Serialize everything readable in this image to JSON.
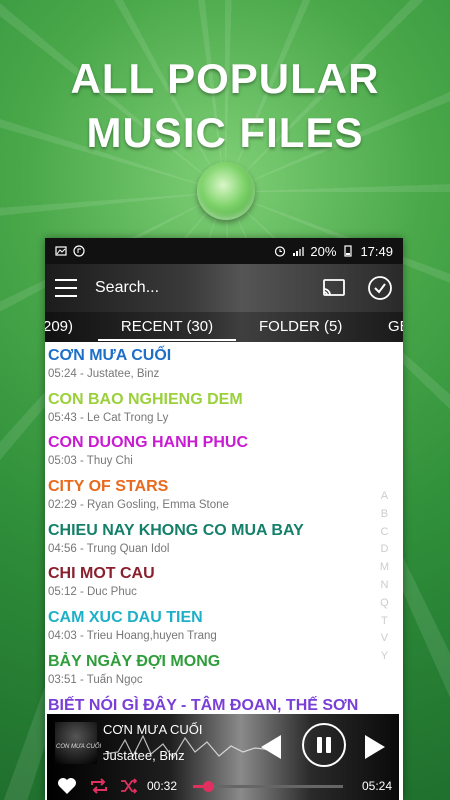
{
  "promo": {
    "line1": "ALL POPULAR",
    "line2": "MUSIC FILES"
  },
  "statusbar": {
    "battery": "20%",
    "time": "17:49"
  },
  "toolbar": {
    "search_placeholder": "Search..."
  },
  "tabs": [
    {
      "label": "209)"
    },
    {
      "label": "RECENT (30)"
    },
    {
      "label": "FOLDER (5)"
    },
    {
      "label": "GE"
    }
  ],
  "songs": [
    {
      "title": "CƠN MƯA CUỐI",
      "meta": "05:24 - Justatee, Binz",
      "color": "#1e6fc8"
    },
    {
      "title": "CON BAO NGHIENG DEM",
      "meta": "05:43 - Le Cat Trong Ly",
      "color": "#9ad13a"
    },
    {
      "title": "CON DUONG HANH PHUC",
      "meta": "05:03 - Thuy Chi",
      "color": "#c91bd1"
    },
    {
      "title": "CITY OF STARS",
      "meta": "02:29 - Ryan Gosling, Emma Stone",
      "color": "#e86a1e"
    },
    {
      "title": "CHIEU NAY KHONG CO MUA BAY",
      "meta": "04:56 - Trung Quan Idol",
      "color": "#15806a"
    },
    {
      "title": "CHI MOT CAU",
      "meta": "05:12 - Duc Phuc",
      "color": "#8a1f2e"
    },
    {
      "title": "CAM XUC DAU TIEN",
      "meta": "04:03 - Trieu Hoang,huyen Trang",
      "color": "#1fb0c9"
    },
    {
      "title": "BẢY NGÀY ĐỢI MONG",
      "meta": "03:51 - Tuấn Ngọc",
      "color": "#2f9e3a"
    },
    {
      "title": "BIẾT NÓI GÌ ĐÂY - TÂM ĐOAN, THẾ SƠN",
      "meta": "",
      "color": "#7a3fd6"
    }
  ],
  "alphabet": [
    "A",
    "B",
    "C",
    "D",
    "M",
    "N",
    "Q",
    "T",
    "V",
    "Y"
  ],
  "player": {
    "cover_caption": "CON MƯA CUỐI",
    "title": "CƠN MƯA CUỐI",
    "artist": "Justatee, Binz",
    "current_time": "00:32",
    "total_time": "05:24",
    "progress": 0.1,
    "accent": "#e03060"
  }
}
